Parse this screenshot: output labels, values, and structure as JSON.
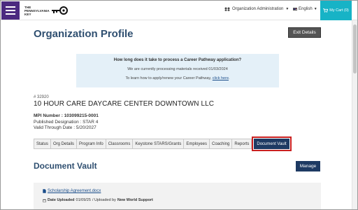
{
  "header": {
    "logo_line1": "THE",
    "logo_line2": "PENNSYLVANIA",
    "logo_line3": "KEY",
    "org_admin_label": "Organization Administration",
    "language_label": "English",
    "cart_label": "My Cart (0)"
  },
  "page": {
    "title": "Organization Profile",
    "exit_label": "Exit Details"
  },
  "info_box": {
    "question": "How long does it take to process a Career Pathway application?",
    "processing_text": "We are currently processing materials received 01/03/2024",
    "renew_prefix": "To learn how to apply/renew your Career Pathway, ",
    "renew_link": "click here",
    "renew_suffix": "."
  },
  "org": {
    "id": "# 32920",
    "name": "10 HOUR CARE DAYCARE CENTER DOWNTOWN LLC",
    "mpi_label": "MPI Number : 103099215-0001",
    "designation": "Published Designation : STAR 4",
    "valid_through": "Valid Through Date : 5/20/2027"
  },
  "tabs": [
    {
      "label": "Status"
    },
    {
      "label": "Org Details"
    },
    {
      "label": "Program Info"
    },
    {
      "label": "Classrooms"
    },
    {
      "label": "Keystone STARS/Grants"
    },
    {
      "label": "Employees"
    },
    {
      "label": "Coaching"
    },
    {
      "label": "Reports"
    },
    {
      "label": "Document Vault"
    }
  ],
  "vault": {
    "title": "Document Vault",
    "manage_label": "Manage",
    "document": {
      "filename": "Scholarship Agreement.docx",
      "uploaded_label": "Date Uploaded",
      "uploaded_date": "01/09/25",
      "uploaded_by_label": "/ Uploaded by",
      "uploaded_by": "New World Support"
    }
  },
  "colors": {
    "menu_bg": "#4b2a80",
    "cart_bg": "#17b3c6",
    "title_color": "#2f4f70",
    "active_tab_bg": "#1e3a63",
    "highlight_border": "#c91f1f",
    "info_bg": "#e4f0f8"
  },
  "icons": {
    "menu": "hamburger-icon",
    "key_logo": "key-logo",
    "org_admin": "network-icon",
    "flag": "us-flag-icon",
    "cart": "cart-icon",
    "doc": "document-icon",
    "calendar": "calendar-icon"
  }
}
